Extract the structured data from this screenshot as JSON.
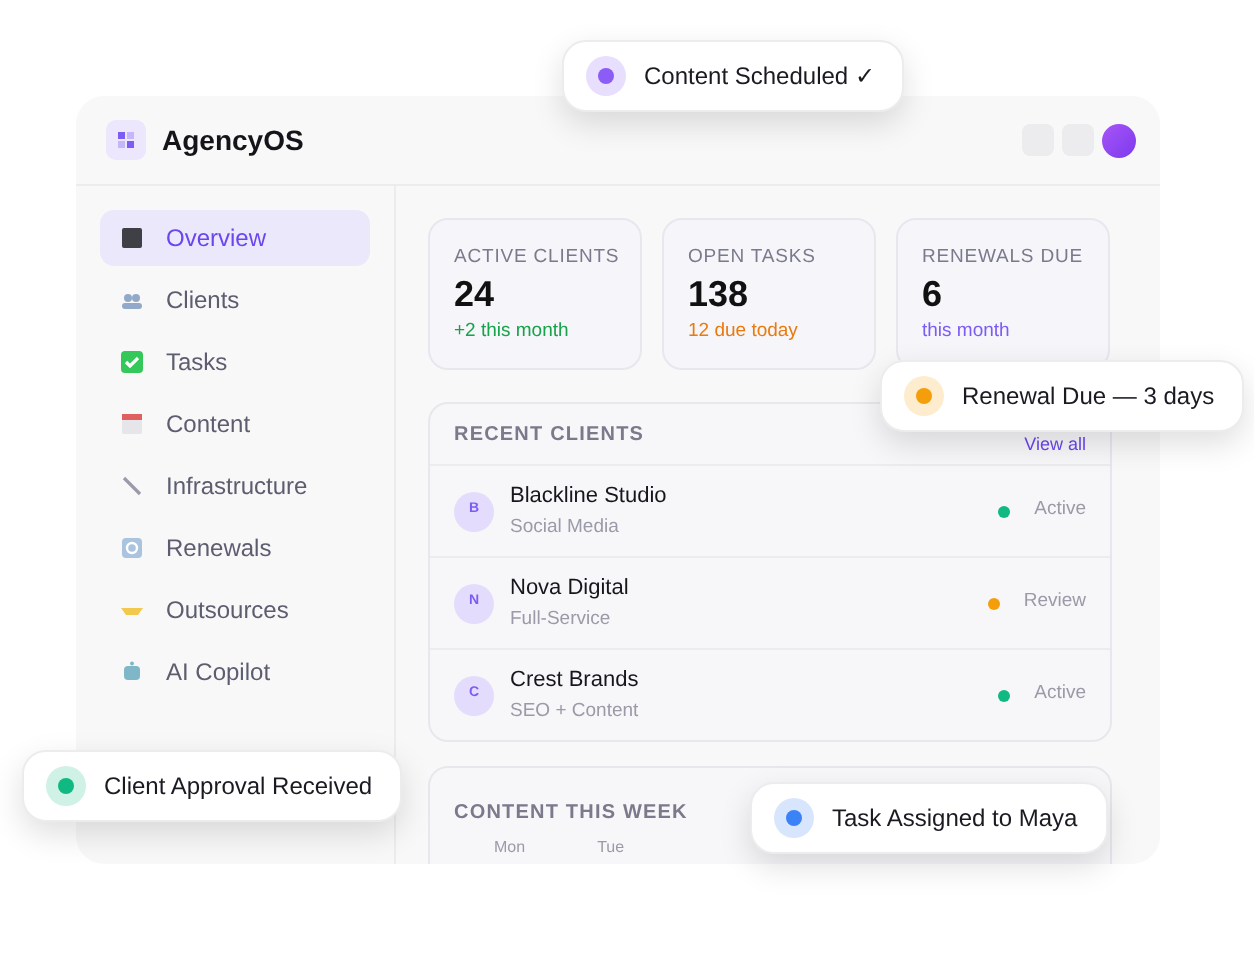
{
  "app": {
    "title": "AgencyOS"
  },
  "sidebar": {
    "items": [
      {
        "label": "Overview",
        "selected": true
      },
      {
        "label": "Clients",
        "selected": false
      },
      {
        "label": "Tasks",
        "selected": false
      },
      {
        "label": "Content",
        "selected": false
      },
      {
        "label": "Infrastructure",
        "selected": false
      },
      {
        "label": "Renewals",
        "selected": false
      },
      {
        "label": "Outsources",
        "selected": false
      },
      {
        "label": "AI Copilot",
        "selected": false
      }
    ]
  },
  "stats": [
    {
      "label": "ACTIVE CLIENTS",
      "value": "24",
      "note": "+2 this month",
      "color": "#16a34a"
    },
    {
      "label": "OPEN TASKS",
      "value": "138",
      "note": "12 due today",
      "color": "#ea7a0c"
    },
    {
      "label": "RENEWALS DUE",
      "value": "6",
      "note": "this month",
      "color": "#7c5cf5"
    }
  ],
  "recent_clients": {
    "title": "RECENT CLIENTS",
    "link": "View all",
    "rows": [
      {
        "initial": "B",
        "name": "Blackline Studio",
        "service": "Social Media",
        "status": "Active",
        "color": "#10b981"
      },
      {
        "initial": "N",
        "name": "Nova Digital",
        "service": "Full-Service",
        "status": "Review",
        "color": "#f59e0b"
      },
      {
        "initial": "C",
        "name": "Crest Brands",
        "service": "SEO + Content",
        "status": "Active",
        "color": "#10b981"
      }
    ]
  },
  "content_week": {
    "title": "CONTENT THIS WEEK",
    "days": [
      "Mon",
      "Tue"
    ]
  },
  "notifications": [
    {
      "text": "Content Scheduled ✓",
      "color": "#8b5cf6"
    },
    {
      "text": "Renewal Due — 3 days",
      "color": "#f59e0b"
    },
    {
      "text": "Client Approval Received",
      "color": "#10b981"
    },
    {
      "text": "Task Assigned to Maya",
      "color": "#3b82f6"
    }
  ]
}
